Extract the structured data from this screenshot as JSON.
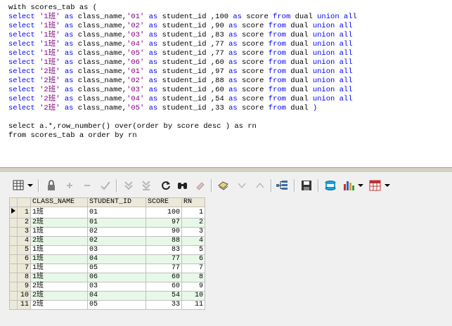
{
  "editor": {
    "line1": "with scores_tab as (",
    "rows": [
      {
        "cls": "'1班'",
        "sid": "'01'",
        "score": "100",
        "tail": "union all"
      },
      {
        "cls": "'1班'",
        "sid": "'02'",
        "score": "90",
        "tail": "union all"
      },
      {
        "cls": "'1班'",
        "sid": "'03'",
        "score": "83",
        "tail": "union all"
      },
      {
        "cls": "'1班'",
        "sid": "'04'",
        "score": "77",
        "tail": "union all"
      },
      {
        "cls": "'1班'",
        "sid": "'05'",
        "score": "77",
        "tail": "union all"
      },
      {
        "cls": "'1班'",
        "sid": "'06'",
        "score": "60",
        "tail": "union all"
      },
      {
        "cls": "'2班'",
        "sid": "'01'",
        "score": "97",
        "tail": "union all"
      },
      {
        "cls": "'2班'",
        "sid": "'02'",
        "score": "88",
        "tail": "union all"
      },
      {
        "cls": "'2班'",
        "sid": "'03'",
        "score": "60",
        "tail": "union all"
      },
      {
        "cls": "'2班'",
        "sid": "'04'",
        "score": "54",
        "tail": "union all"
      },
      {
        "cls": "'2班'",
        "sid": "'05'",
        "score": "33",
        "tail": ")"
      }
    ],
    "q1": "select a.*,row_number() over(order by score desc ) as rn",
    "q2": "from scores_tab a order by rn"
  },
  "grid": {
    "columns": [
      "CLASS_NAME",
      "STUDENT_ID",
      "SCORE",
      "RN"
    ],
    "rows": [
      [
        "1",
        "1班",
        "01",
        "100",
        "1"
      ],
      [
        "2",
        "2班",
        "01",
        "97",
        "2"
      ],
      [
        "3",
        "1班",
        "02",
        "90",
        "3"
      ],
      [
        "4",
        "2班",
        "02",
        "88",
        "4"
      ],
      [
        "5",
        "1班",
        "03",
        "83",
        "5"
      ],
      [
        "6",
        "1班",
        "04",
        "77",
        "6"
      ],
      [
        "7",
        "1班",
        "05",
        "77",
        "7"
      ],
      [
        "8",
        "1班",
        "06",
        "60",
        "8"
      ],
      [
        "9",
        "2班",
        "03",
        "60",
        "9"
      ],
      [
        "10",
        "2班",
        "04",
        "54",
        "10"
      ],
      [
        "11",
        "2班",
        "05",
        "33",
        "11"
      ]
    ]
  },
  "toolbar_icons": [
    "grid-view-icon",
    "lock-icon",
    "add-record-icon",
    "delete-record-icon",
    "post-edit-icon",
    "fetch-next-icon",
    "fetch-all-icon",
    "refresh-icon",
    "find-icon",
    "clear-icon",
    "query-by-example-icon",
    "previous-icon",
    "next-icon",
    "single-record-view-icon",
    "save-icon",
    "export-icon",
    "chart-icon",
    "table-icon"
  ]
}
